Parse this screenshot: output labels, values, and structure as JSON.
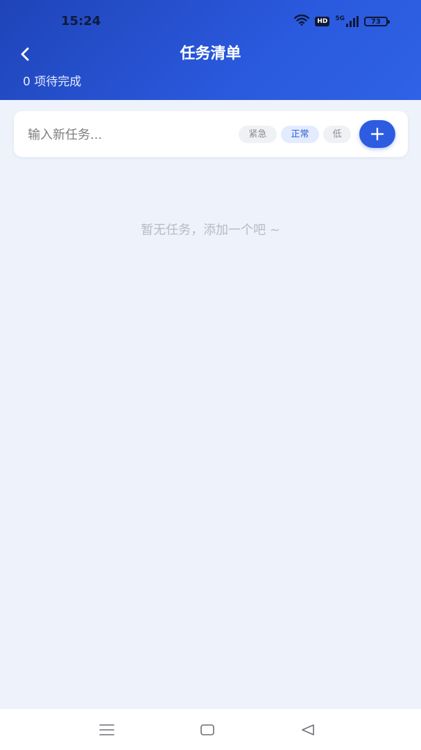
{
  "status_bar": {
    "time": "15:24",
    "hd_label": "HD",
    "network_label": "5G",
    "battery_level": "73",
    "icons": [
      "wifi-icon",
      "hd-icon",
      "signal-5g-icon",
      "battery-icon"
    ]
  },
  "header": {
    "title": "任务清单",
    "pending_text": "0 项待完成",
    "back_icon": "chevron-left-icon",
    "gradient_start": "#1f44b8",
    "gradient_end": "#2f62e6"
  },
  "task_input": {
    "placeholder": "输入新任务...",
    "value": ""
  },
  "priority": {
    "options": [
      "紧急",
      "正常",
      "低"
    ],
    "selected": "正常"
  },
  "add_button": {
    "icon": "plus-icon",
    "color": "#2d5ce0"
  },
  "empty_state": {
    "message": "暂无任务，添加一个吧 ~"
  },
  "nav_bar": {
    "icons": [
      "menu-icon",
      "home-icon",
      "back-triangle-icon"
    ]
  }
}
